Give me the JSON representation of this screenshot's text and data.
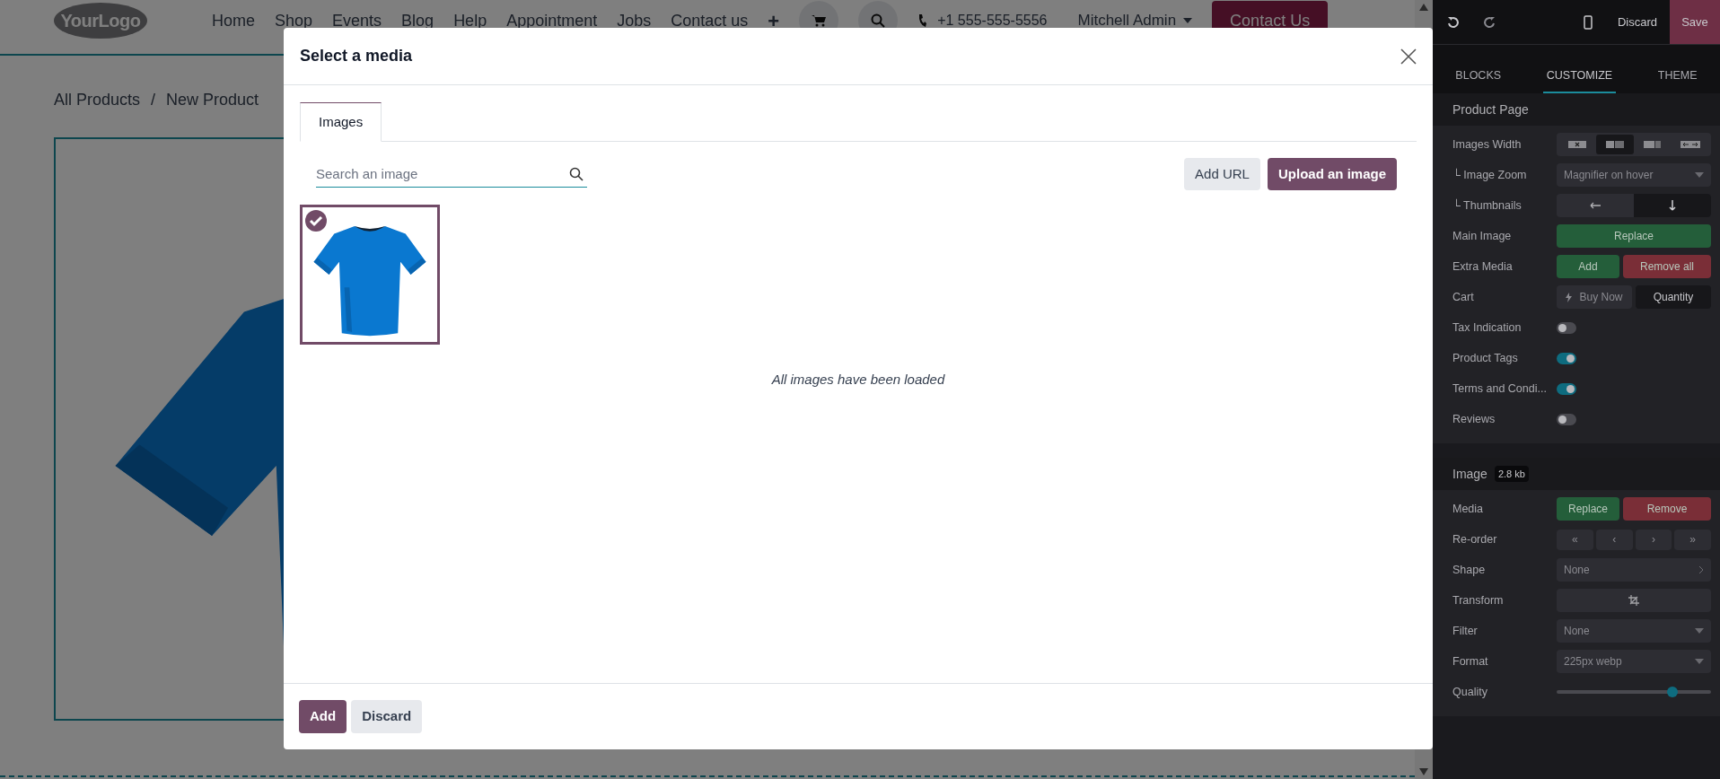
{
  "site": {
    "logo": "YourLogo",
    "nav": [
      "Home",
      "Shop",
      "Events",
      "Blog",
      "Help",
      "Appointment",
      "Jobs",
      "Contact us"
    ],
    "add_item": "+",
    "phone": "+1 555-555-5556",
    "user": "Mitchell Admin",
    "cta": "Contact Us",
    "breadcrumb": [
      "All Products",
      "/",
      "New Product"
    ]
  },
  "modal": {
    "title": "Select a media",
    "tabs": [
      {
        "label": "Images",
        "selected": true
      }
    ],
    "search": {
      "placeholder": "Search an image"
    },
    "actions": [
      {
        "label": "Add URL",
        "kind": "secondary"
      },
      {
        "label": "Upload an image",
        "kind": "primary"
      }
    ],
    "images": [
      {
        "kind": "picture",
        "selected": true
      }
    ],
    "status": "All images have been loaded",
    "footer_buttons": [
      {
        "label": "Add",
        "kind": "primary"
      },
      {
        "label": "Discard",
        "kind": "secondary"
      }
    ]
  },
  "editor": {
    "discard": "Discard",
    "save": "Save",
    "tabs": [
      {
        "label": "BLOCKS",
        "selected": false
      },
      {
        "label": "CUSTOMIZE",
        "selected": true
      },
      {
        "label": "THEME",
        "selected": false
      }
    ],
    "sections": [
      {
        "title": "Product Page",
        "rows": [
          {
            "label": "Images Width",
            "kind": "icon_segmented",
            "options": [
              {
                "selected": false
              },
              {
                "selected": true
              },
              {
                "selected": false
              },
              {
                "selected": false
              }
            ]
          },
          {
            "label": "└ Image Zoom",
            "kind": "select",
            "value": "Magnifier on hover"
          },
          {
            "label": "└ Thumbnails",
            "kind": "arrow_segmented",
            "options": [
              {
                "selected": false
              },
              {
                "selected": true
              }
            ]
          },
          {
            "label": "Main Image",
            "kind": "buttons",
            "buttons": [
              {
                "label": "Replace",
                "color": "#245e3a"
              }
            ]
          },
          {
            "label": "Extra Media",
            "kind": "buttons",
            "buttons": [
              {
                "label": "Add",
                "color": "#245e3a"
              },
              {
                "label": "Remove all",
                "color": "#7a2e37"
              }
            ]
          },
          {
            "label": "Cart",
            "kind": "text_segmented",
            "options": [
              {
                "label": "Buy Now",
                "has_icon": true,
                "selected": false
              },
              {
                "label": "Quantity",
                "has_icon": false,
                "selected": true
              }
            ]
          },
          {
            "label": "Tax Indication",
            "kind": "toggle",
            "on": false
          },
          {
            "label": "Product Tags",
            "kind": "toggle",
            "on": true
          },
          {
            "label": "Terms and Condi...",
            "kind": "toggle",
            "on": true
          },
          {
            "label": "Reviews",
            "kind": "toggle",
            "on": false
          }
        ]
      },
      {
        "title": "Image",
        "badge": "2.8 kb",
        "rows": [
          {
            "label": "Media",
            "kind": "buttons",
            "buttons": [
              {
                "label": "Replace",
                "color": "#245e3a"
              },
              {
                "label": "Remove",
                "color": "#7a2e37"
              }
            ]
          },
          {
            "label": "Re-order",
            "kind": "stepper",
            "glyphs": [
              "«",
              "‹",
              "›",
              "»"
            ]
          },
          {
            "label": "Shape",
            "kind": "picker",
            "value": "None"
          },
          {
            "label": "Transform",
            "kind": "icon_button"
          },
          {
            "label": "Filter",
            "kind": "select",
            "value": "None"
          },
          {
            "label": "Format",
            "kind": "select",
            "value": "225px webp"
          },
          {
            "label": "Quality",
            "kind": "slider",
            "level": 0.75
          }
        ]
      }
    ]
  }
}
